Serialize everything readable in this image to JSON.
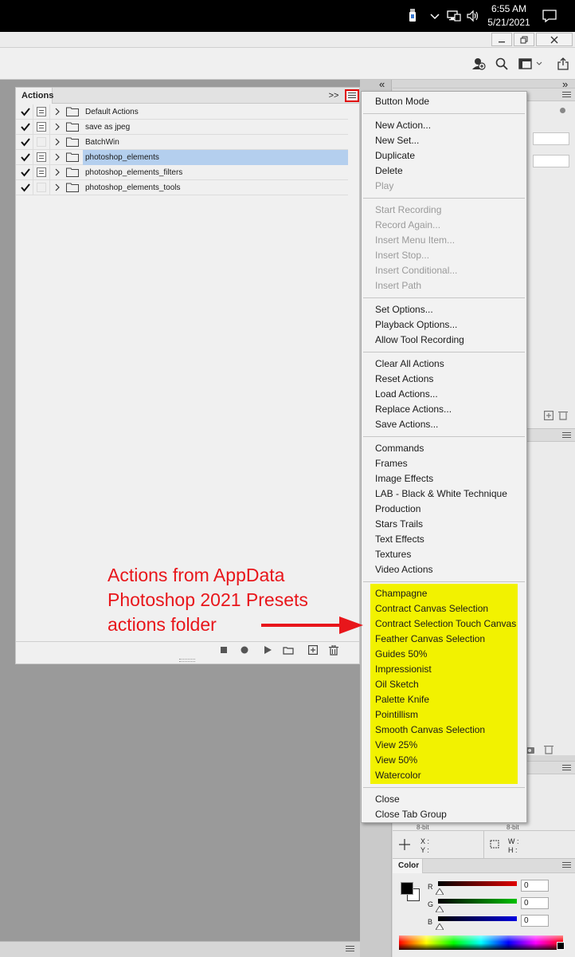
{
  "taskbar": {
    "time": "6:55 AM",
    "date": "5/21/2021",
    "icons": [
      "usb-drive-icon",
      "chevron-up-icon",
      "network-icon",
      "volume-icon",
      "notification-icon"
    ]
  },
  "window": {
    "buttons": [
      "minimize-icon",
      "restore-icon",
      "close-icon"
    ]
  },
  "options_bar": {
    "icons": [
      "user-icon",
      "search-icon",
      "workspace-icon",
      "share-icon"
    ]
  },
  "actions_panel": {
    "tab_label": "Actions",
    "collapse_glyph": ">>",
    "rows": [
      {
        "name": "Default Actions",
        "checked": true,
        "dialog": true,
        "selected": false
      },
      {
        "name": "save as jpeg",
        "checked": true,
        "dialog": true,
        "selected": false
      },
      {
        "name": "BatchWin",
        "checked": true,
        "dialog": false,
        "selected": false
      },
      {
        "name": "photoshop_elements",
        "checked": true,
        "dialog": true,
        "selected": true
      },
      {
        "name": "photoshop_elements_filters",
        "checked": true,
        "dialog": true,
        "selected": false
      },
      {
        "name": "photoshop_elements_tools",
        "checked": true,
        "dialog": false,
        "selected": false
      }
    ],
    "footer_icons": [
      "stop-icon",
      "record-icon",
      "play-icon",
      "new-set-icon",
      "new-action-icon",
      "delete-icon"
    ]
  },
  "menu": {
    "groups": [
      [
        {
          "label": "Button Mode",
          "disabled": false
        }
      ],
      [
        {
          "label": "New Action...",
          "disabled": false
        },
        {
          "label": "New Set...",
          "disabled": false
        },
        {
          "label": "Duplicate",
          "disabled": false
        },
        {
          "label": "Delete",
          "disabled": false
        },
        {
          "label": "Play",
          "disabled": true
        }
      ],
      [
        {
          "label": "Start Recording",
          "disabled": true
        },
        {
          "label": "Record Again...",
          "disabled": true
        },
        {
          "label": "Insert Menu Item...",
          "disabled": true
        },
        {
          "label": "Insert Stop...",
          "disabled": true
        },
        {
          "label": "Insert Conditional...",
          "disabled": true
        },
        {
          "label": "Insert Path",
          "disabled": true
        }
      ],
      [
        {
          "label": "Set Options...",
          "disabled": false
        },
        {
          "label": "Playback Options...",
          "disabled": false
        },
        {
          "label": "Allow Tool Recording",
          "disabled": false
        }
      ],
      [
        {
          "label": "Clear All Actions",
          "disabled": false
        },
        {
          "label": "Reset Actions",
          "disabled": false
        },
        {
          "label": "Load Actions...",
          "disabled": false
        },
        {
          "label": "Replace Actions...",
          "disabled": false
        },
        {
          "label": "Save Actions...",
          "disabled": false
        }
      ],
      [
        {
          "label": "Commands",
          "disabled": false
        },
        {
          "label": "Frames",
          "disabled": false
        },
        {
          "label": "Image Effects",
          "disabled": false
        },
        {
          "label": "LAB - Black & White Technique",
          "disabled": false
        },
        {
          "label": "Production",
          "disabled": false
        },
        {
          "label": "Stars Trails",
          "disabled": false
        },
        {
          "label": "Text Effects",
          "disabled": false
        },
        {
          "label": "Textures",
          "disabled": false
        },
        {
          "label": "Video Actions",
          "disabled": false
        }
      ],
      [
        {
          "label": "Champagne",
          "disabled": false
        },
        {
          "label": "Contract Canvas Selection",
          "disabled": false
        },
        {
          "label": "Contract Selection Touch Canvas",
          "disabled": false
        },
        {
          "label": "Feather Canvas Selection",
          "disabled": false
        },
        {
          "label": "Guides 50%",
          "disabled": false
        },
        {
          "label": "Impressionist",
          "disabled": false
        },
        {
          "label": "Oil Sketch",
          "disabled": false
        },
        {
          "label": "Palette Knife",
          "disabled": false
        },
        {
          "label": "Pointillism",
          "disabled": false
        },
        {
          "label": "Smooth Canvas Selection",
          "disabled": false
        },
        {
          "label": "View 25%",
          "disabled": false
        },
        {
          "label": "View 50%",
          "disabled": false
        },
        {
          "label": "Watercolor",
          "disabled": false
        }
      ],
      [
        {
          "label": "Close",
          "disabled": false
        },
        {
          "label": "Close Tab Group",
          "disabled": false
        }
      ]
    ],
    "highlight_color": "#f2f200"
  },
  "annotation": {
    "lines": [
      "Actions from AppData",
      "Photoshop 2021 Presets",
      "actions folder"
    ],
    "color": "#e8161b"
  },
  "dock": {
    "collapse_left": "«",
    "collapse_right": "»",
    "bit_label_1": "8-bit",
    "bit_label_2": "8-bit",
    "x_label": "X :",
    "y_label": "Y :",
    "w_label": "W :",
    "h_label": "H :"
  },
  "color_panel": {
    "tab_label": "Color",
    "channels": [
      {
        "label": "R",
        "value": "0",
        "color": "#e00000"
      },
      {
        "label": "G",
        "value": "0",
        "color": "#00c000"
      },
      {
        "label": "B",
        "value": "0",
        "color": "#0000e0"
      }
    ]
  }
}
